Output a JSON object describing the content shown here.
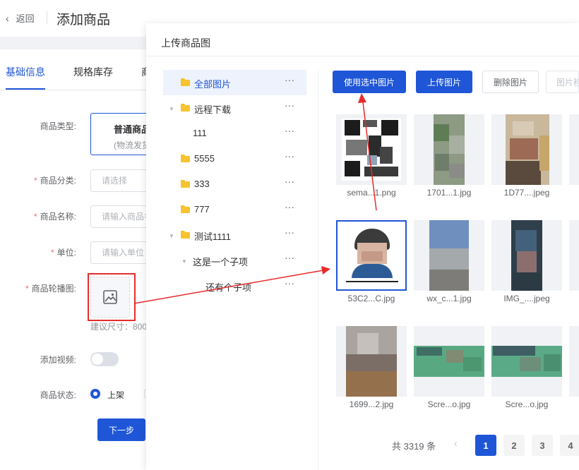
{
  "header": {
    "back_label": "返回",
    "title": "添加商品"
  },
  "tabs": [
    {
      "label": "基础信息",
      "active": true
    },
    {
      "label": "规格库存",
      "active": false
    },
    {
      "label": "商",
      "active": false
    }
  ],
  "form": {
    "type_label": "商品类型:",
    "type_card_title": "普通商品",
    "type_card_sub": "(物流发货)",
    "category_label": "商品分类:",
    "category_placeholder": "请选择",
    "name_label": "商品名称:",
    "name_placeholder": "请输入商品名称",
    "unit_label": "单位:",
    "unit_placeholder": "请输入单位",
    "carousel_label": "商品轮播图:",
    "carousel_hint": "建议尺寸：800",
    "video_label": "添加视频:",
    "video_enabled": false,
    "status_label": "商品状态:",
    "status_option": "上架",
    "next_button": "下一步"
  },
  "dialog": {
    "title": "上传商品图",
    "tree": [
      {
        "label": "全部图片",
        "selected": true,
        "folder": true,
        "caret": false
      },
      {
        "label": "远程下载",
        "selected": false,
        "folder": true,
        "caret": true
      },
      {
        "label": "111",
        "selected": false,
        "folder": false,
        "caret": false
      },
      {
        "label": "5555",
        "selected": false,
        "folder": true,
        "caret": false
      },
      {
        "label": "333",
        "selected": false,
        "folder": true,
        "caret": false
      },
      {
        "label": "777",
        "selected": false,
        "folder": true,
        "caret": false
      },
      {
        "label": "测试1111",
        "selected": false,
        "folder": true,
        "caret": true
      },
      {
        "label": "这是一个子项",
        "selected": false,
        "folder": false,
        "caret": true
      },
      {
        "label": "还有个子项",
        "selected": false,
        "folder": false,
        "caret": false
      }
    ],
    "more_glyph": "···",
    "buttons": {
      "use_selected": "使用选中图片",
      "upload": "上传图片",
      "delete": "删除图片",
      "move": "图片移动"
    },
    "images": [
      {
        "caption": "sema...1.png",
        "selected": false
      },
      {
        "caption": "1701...1.jpg",
        "selected": false
      },
      {
        "caption": "1D77....jpeg",
        "selected": false
      },
      {
        "caption": "53C2...C.jpg",
        "selected": true,
        "order": "1"
      },
      {
        "caption": "wx_c...1.jpg",
        "selected": false
      },
      {
        "caption": "IMG_....jpeg",
        "selected": false
      },
      {
        "caption": "1699...2.jpg",
        "selected": false
      },
      {
        "caption": "Scre...o.jpg",
        "selected": false
      },
      {
        "caption": "Scre...o.jpg",
        "selected": false
      }
    ],
    "pagination": {
      "total_text": "共 3319 条",
      "prev_glyph": "‹",
      "pages": [
        "1",
        "2",
        "3",
        "4"
      ],
      "current": "1"
    }
  },
  "colors": {
    "primary": "#1f56d7",
    "annotation_red": "#e62b2b",
    "folder": "#f7c32e"
  }
}
